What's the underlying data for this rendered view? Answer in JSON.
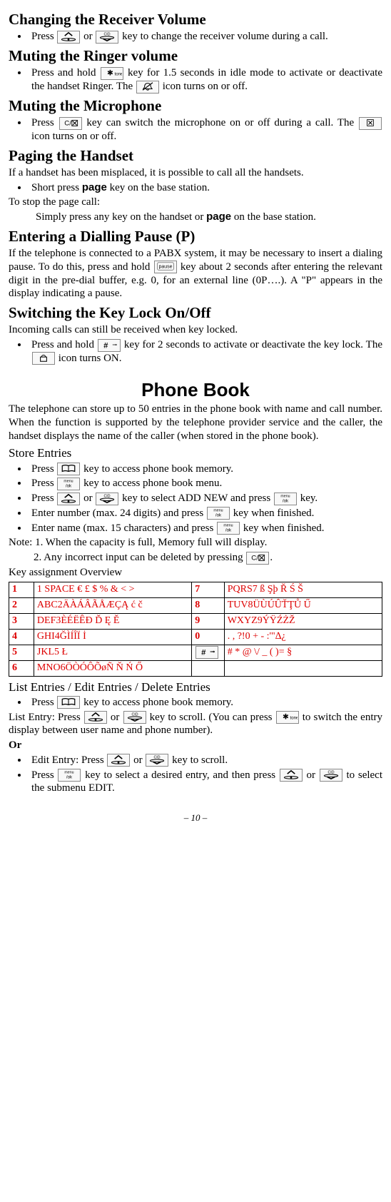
{
  "s1": {
    "title": "Changing the Receiver Volume",
    "b1a": "Press ",
    "b1b": " or ",
    "b1c": " key to change the receiver volume during a call."
  },
  "s2": {
    "title": "Muting the Ringer volume",
    "b1a": "Press and hold ",
    "b1b": " key for 1.5 seconds in idle mode to activate or deactivate the handset Ringer. The ",
    "b1c": " icon turns on or off."
  },
  "s3": {
    "title": "Muting the Microphone",
    "b1a": "Press ",
    "b1b": " key can switch the microphone on or off during a call. The ",
    "b1c": " icon turns on or off."
  },
  "s4": {
    "title": "Paging the Handset",
    "p1": "If a handset has been misplaced, it is possible to call all the handsets.",
    "b1": "Short press ",
    "b1k": "page",
    "b1e": " key on the base station.",
    "p2": "To stop the page call:",
    "p3a": "Simply press any key on the handset or ",
    "p3k": "page",
    "p3b": " on the base station."
  },
  "s5": {
    "title": "Entering a Dialling Pause (P)",
    "p1a": "If the telephone is connected to a PABX system, it may be necessary to insert a dialing pause. To do this, press and hold ",
    "p1b": " key about 2 seconds after entering the relevant digit in the pre-dial buffer, e.g. 0, for an external line (0P….). A \"P\" appears in the display indicating a pause."
  },
  "s6": {
    "title": "Switching the Key Lock On/Off",
    "p1": "Incoming calls can still be received when key locked.",
    "b1a": "Press and hold ",
    "b1b": " key for 2 seconds to activate or deactivate the key lock. The ",
    "b1c": " icon turns ON."
  },
  "ch": {
    "title": "Phone Book",
    "intro": "The telephone can store up to 50 entries in the phone book with name and call number. When the function is supported by the telephone provider service and the caller, the handset displays the name of the caller (when stored in the phone book).",
    "sub1": "Store Entries",
    "b1a": "Press ",
    "b1b": " key to access phone book memory.",
    "b2a": "Press ",
    "b2b": " key to access phone book menu.",
    "b3a": "Press ",
    "b3b": " or ",
    "b3c": " key to select ADD NEW and press ",
    "b3d": " key.",
    "b4a": "Enter number (max. 24 digits) and press ",
    "b4b": " key when finished.",
    "b5a": "Enter name (max. 15 characters) and press ",
    "b5b": " key when finished.",
    "note1": "Note: 1. When the capacity is full, Memory full will display.",
    "note2a": "2. Any incorrect input can be deleted by pressing ",
    "note2b": ".",
    "keyhead": "Key assignment Overview",
    "rows": [
      {
        "n": "1",
        "c": "1 SPACE € £ $ % & < >",
        "n2": "7",
        "c2": "PQRS7 ß Şþ Ř Ś Š"
      },
      {
        "n": "2",
        "c": "ABC2ÄÀÁÂÃÅÆÇĄ ć č",
        "n2": "8",
        "c2": "TUV8ÜÙÚÛŤŢŮ Ű"
      },
      {
        "n": "3",
        "c": "DEF3ÈÉËÊÐ Ď Ę Ě",
        "n2": "9",
        "c2": "WXYZ9ÝŸŹŻŽ"
      },
      {
        "n": "4",
        "c": "GHI4ĞÌÍÎÏ İ",
        "n2": "0",
        "c2": ". , ?!0 + - :'\"∆¿"
      },
      {
        "n": "5",
        "c": "JKL5 Ł",
        "n2": "#",
        "c2": "# * @ \\/ _ ( )= §"
      },
      {
        "n": "6",
        "c": "MNO6ÖÒÓÔÕøÑ Ň Ń Ő",
        "n2": "",
        "c2": ""
      }
    ],
    "sub2": "List Entries / Edit Entries / Delete Entries",
    "lb1a": "Press ",
    "lb1b": " key to access phone book memory.",
    "lp1a": "List Entry: Press ",
    "lp1b": " or ",
    "lp1c": " key to scroll. (You can press ",
    "lp1d": " to switch the entry display between user name and phone number).",
    "or": "Or",
    "eb1a": "Edit Entry: Press ",
    "eb1b": " or ",
    "eb1c": "  key to scroll.",
    "eb2a": "Press ",
    "eb2b": " key to select a desired entry, and then press ",
    "eb2c": " or ",
    "eb2d": " to select the submenu EDIT."
  },
  "footer": "– 10 –"
}
